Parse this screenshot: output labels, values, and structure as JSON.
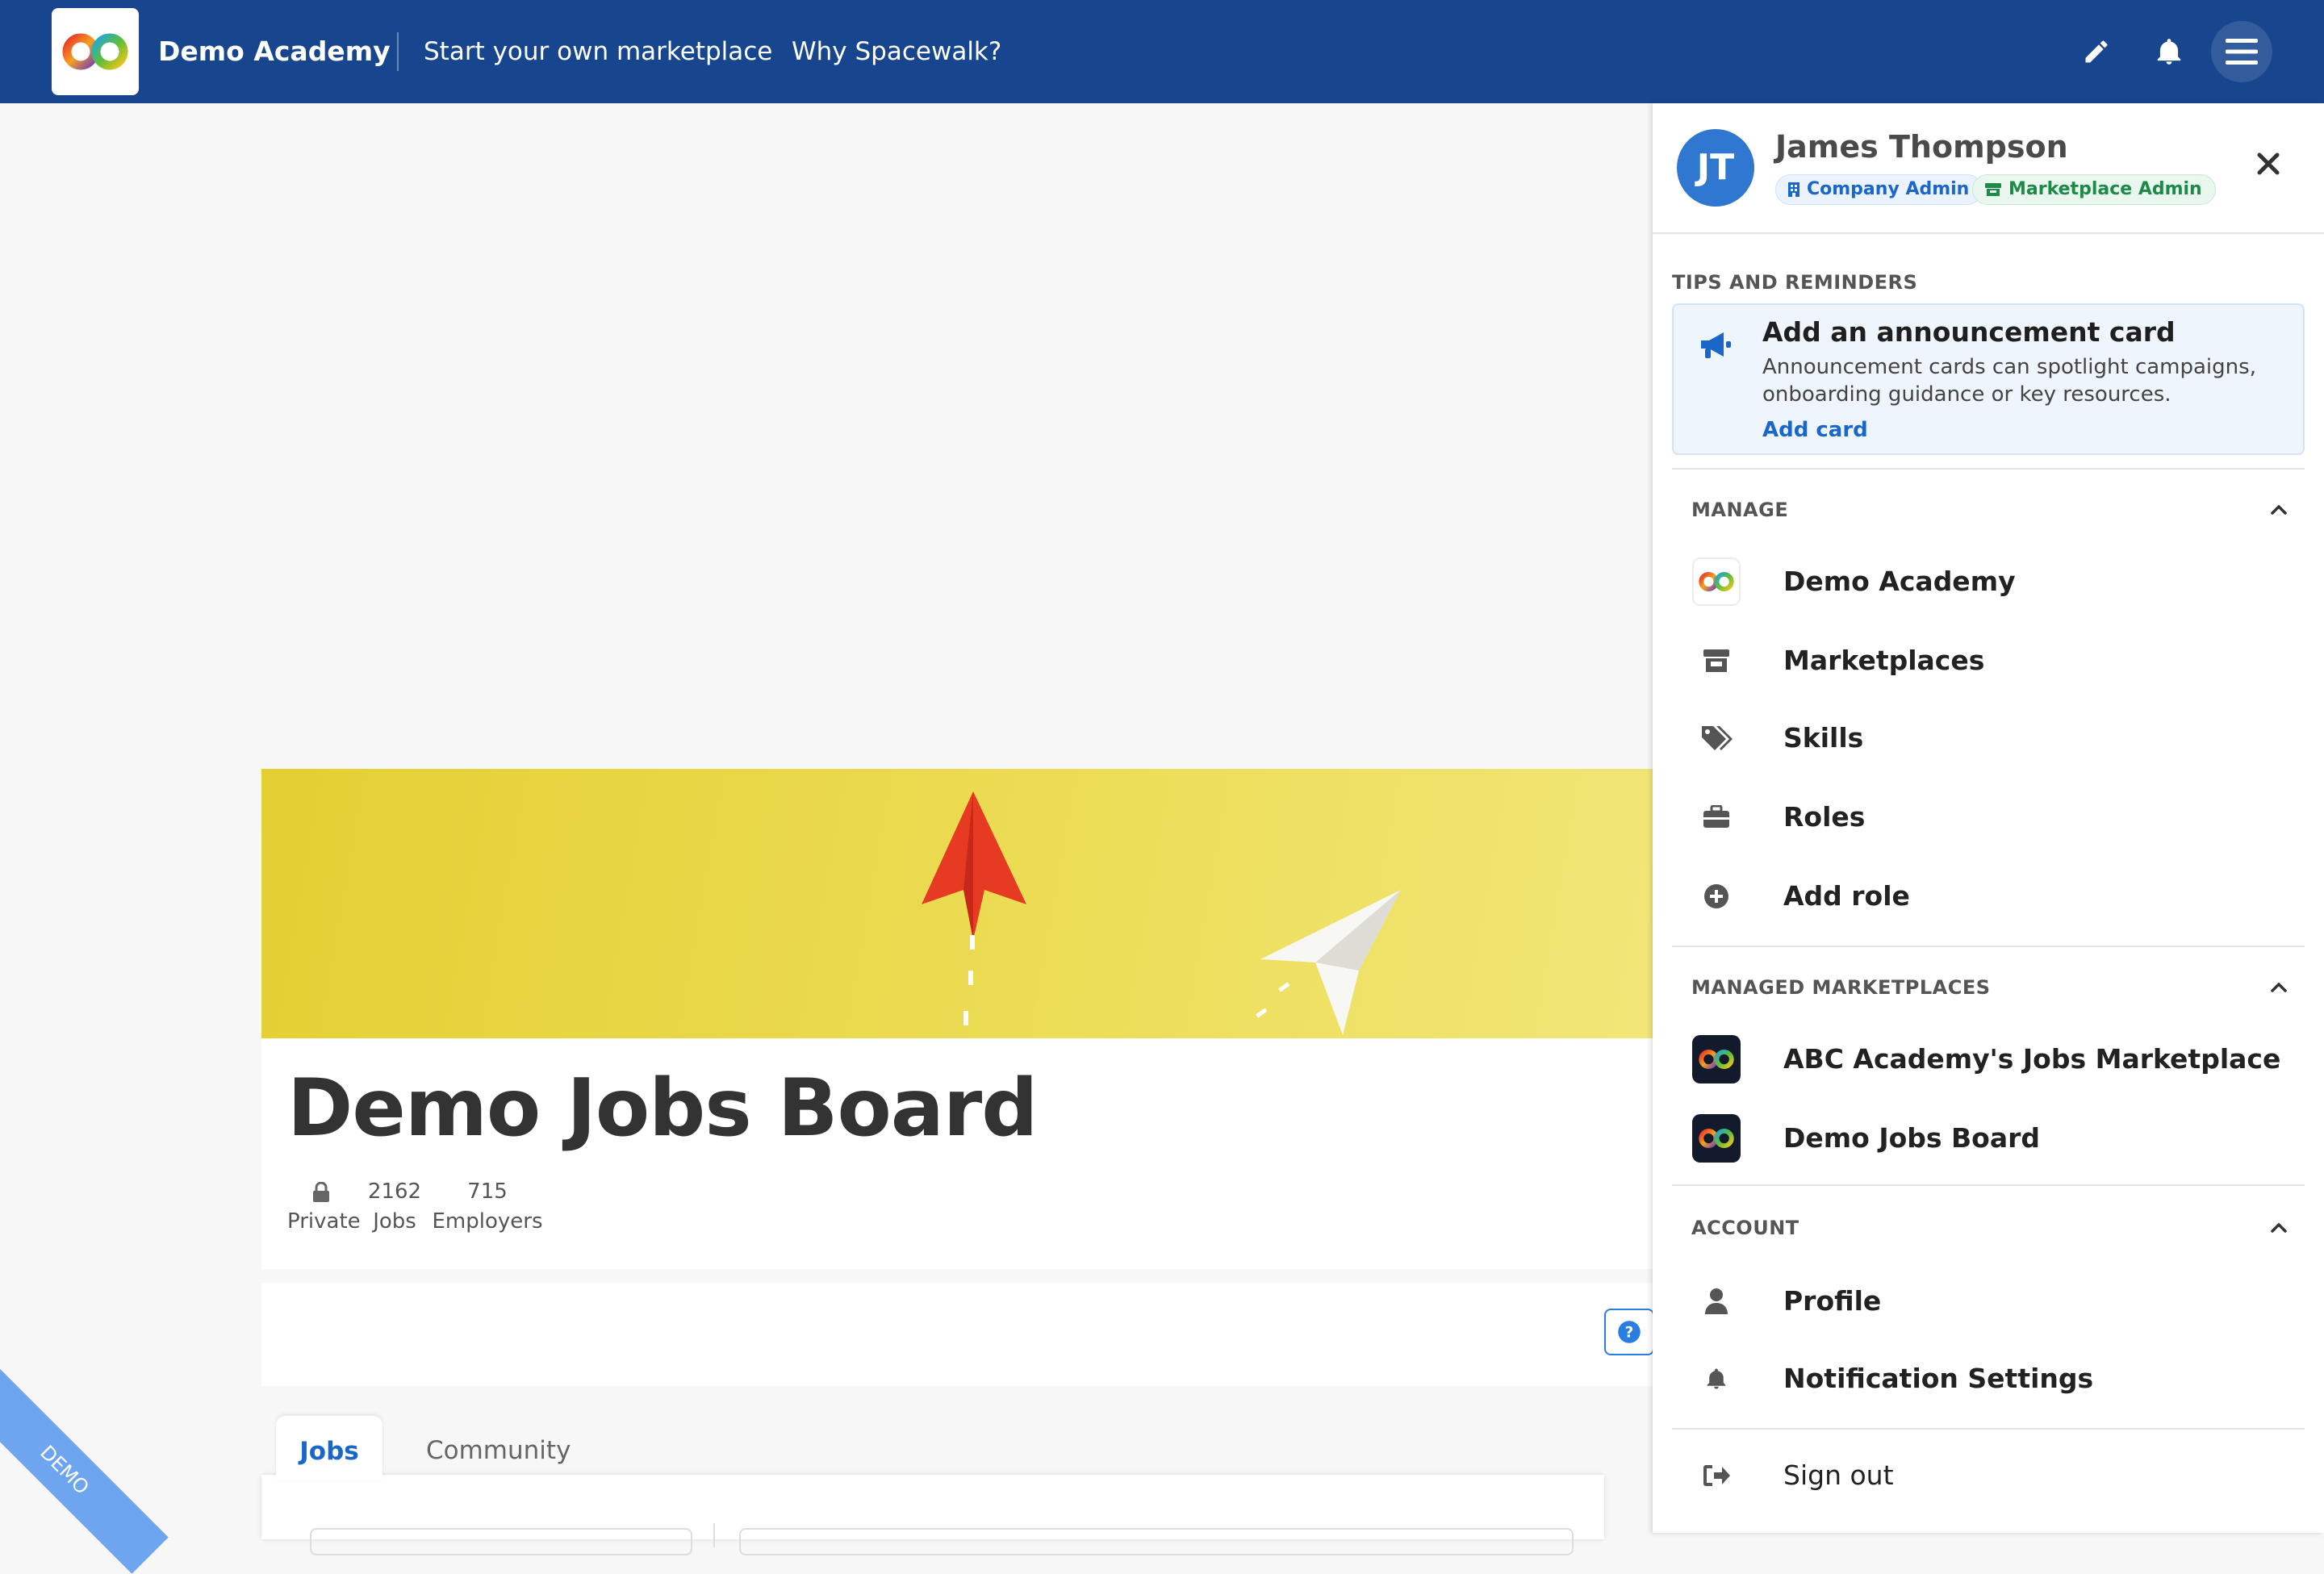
{
  "nav": {
    "brand": "Demo Academy",
    "links": [
      "Start your own marketplace",
      "Why Spacewalk?"
    ],
    "icons": [
      "pencil-icon",
      "bell-icon",
      "hamburger-icon"
    ],
    "color": "#17468f"
  },
  "board": {
    "title": "Demo Jobs Board",
    "stats": [
      {
        "value": "",
        "label": "Private"
      },
      {
        "value": "2162",
        "label": "Jobs"
      },
      {
        "value": "715",
        "label": "Employers"
      }
    ]
  },
  "tabs": [
    "Jobs",
    "Community"
  ],
  "ribbon": "DEMO",
  "drawer": {
    "user": {
      "initials": "JT",
      "name": "James Thompson",
      "badges": [
        "Company Admin",
        "Marketplace Admin"
      ]
    },
    "tips": {
      "heading": "TIPS AND REMINDERS",
      "title": "Add an announcement card",
      "description": "Announcement cards can spotlight campaigns, onboarding guidance or key resources.",
      "link": "Add card"
    },
    "manage": {
      "heading": "MANAGE",
      "items": [
        "Demo Academy",
        "Marketplaces",
        "Skills",
        "Roles",
        "Add role"
      ]
    },
    "managed_marketplaces": {
      "heading": "MANAGED MARKETPLACES",
      "items": [
        "ABC Academy's Jobs Marketplace",
        "Demo Jobs Board"
      ]
    },
    "account": {
      "heading": "ACCOUNT",
      "items": [
        "Profile",
        "Notification Settings"
      ]
    },
    "sign_out": "Sign out"
  }
}
